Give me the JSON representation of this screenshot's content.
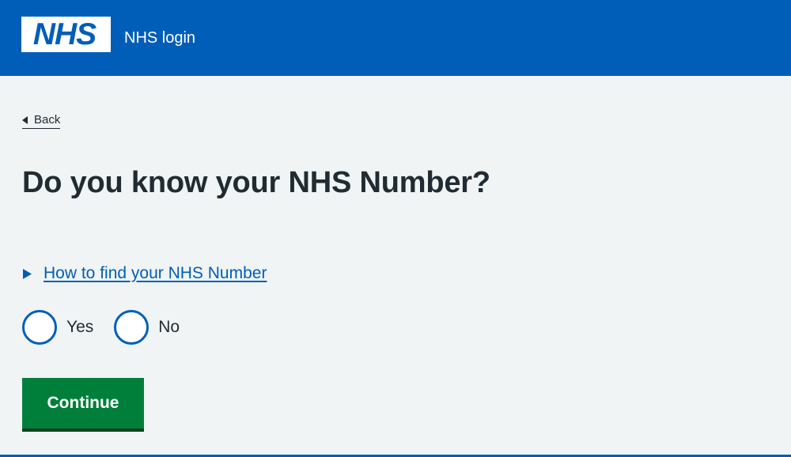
{
  "header": {
    "logo_text": "NHS",
    "service_name": "NHS login"
  },
  "back_link": {
    "label": "Back",
    "icon": "back-triangle-icon"
  },
  "page_title": "Do you know your NHS Number?",
  "details": {
    "label": "How to find your NHS Number",
    "icon": "expand-triangle-icon"
  },
  "radios": {
    "options": [
      {
        "label": "Yes",
        "selected": false
      },
      {
        "label": "No",
        "selected": false
      }
    ]
  },
  "continue_label": "Continue",
  "colors": {
    "brand_blue": "#005eb8",
    "background": "#f0f4f5",
    "button_green": "#007f3b",
    "text": "#212b32"
  }
}
